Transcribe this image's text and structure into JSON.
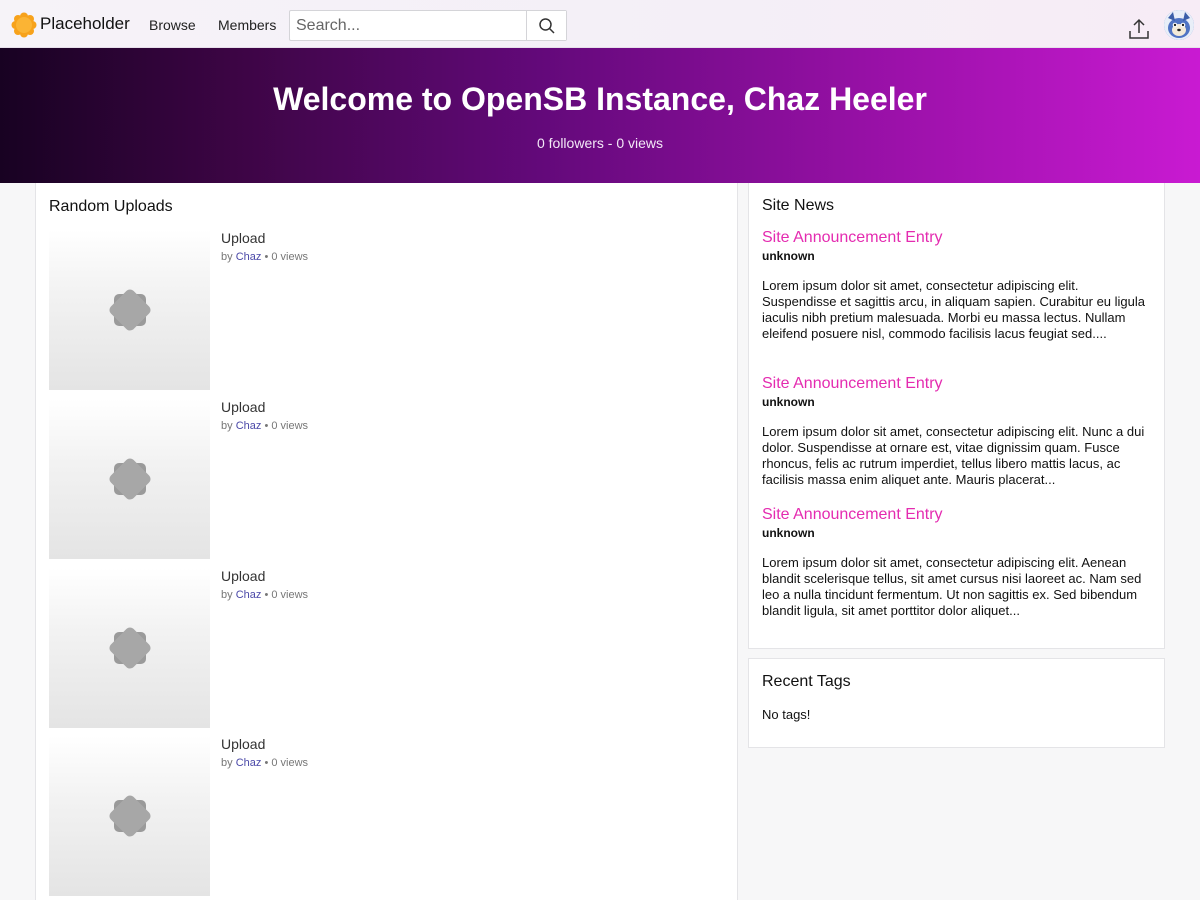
{
  "header": {
    "site_name": "Placeholder",
    "logo_icon": "sunburst-logo-icon",
    "nav": [
      {
        "label": "Browse"
      },
      {
        "label": "Members"
      }
    ],
    "search": {
      "placeholder": "Search...",
      "value": ""
    },
    "icons": [
      "search-icon",
      "upload-icon",
      "avatar"
    ]
  },
  "banner": {
    "title": "Welcome to OpenSB Instance, Chaz Heeler",
    "subtitle": "0 followers - 0 views"
  },
  "uploads": {
    "title": "Random Uploads",
    "items": [
      {
        "title": "Upload",
        "by": "by",
        "author": "Chaz",
        "separator": "•",
        "views": "0 views"
      },
      {
        "title": "Upload",
        "by": "by",
        "author": "Chaz",
        "separator": "•",
        "views": "0 views"
      },
      {
        "title": "Upload",
        "by": "by",
        "author": "Chaz",
        "separator": "•",
        "views": "0 views"
      },
      {
        "title": "Upload",
        "by": "by",
        "author": "Chaz",
        "separator": "•",
        "views": "0 views"
      }
    ]
  },
  "news": {
    "title": "Site News",
    "entries": [
      {
        "title": "Site Announcement Entry",
        "author": "unknown",
        "body": "Lorem ipsum dolor sit amet, consectetur adipiscing elit. Suspendisse et sagittis arcu, in aliquam sapien. Curabitur eu ligula iaculis nibh pretium malesuada. Morbi eu massa lectus. Nullam eleifend posuere nisl, commodo facilisis lacus feugiat sed...."
      },
      {
        "title": "Site Announcement Entry",
        "author": "unknown",
        "body": "Lorem ipsum dolor sit amet, consectetur adipiscing elit. Nunc a dui dolor. Suspendisse at ornare est, vitae dignissim quam. Fusce rhoncus, felis ac rutrum imperdiet, tellus libero mattis lacus, ac facilisis massa enim aliquet ante. Mauris placerat..."
      },
      {
        "title": "Site Announcement Entry",
        "author": "unknown",
        "body": "Lorem ipsum dolor sit amet, consectetur adipiscing elit. Aenean blandit scelerisque tellus, sit amet cursus nisi laoreet ac. Nam sed leo a nulla tincidunt fermentum. Ut non sagittis ex. Sed bibendum blandit ligula, sit amet porttitor dolor aliquet..."
      }
    ]
  },
  "tags": {
    "title": "Recent Tags",
    "empty_text": "No tags!"
  },
  "colors": {
    "accent_pink": "#e42bb0",
    "author_link": "#4b49a8",
    "banner_start": "#180222",
    "banner_end": "#c91ad2"
  }
}
